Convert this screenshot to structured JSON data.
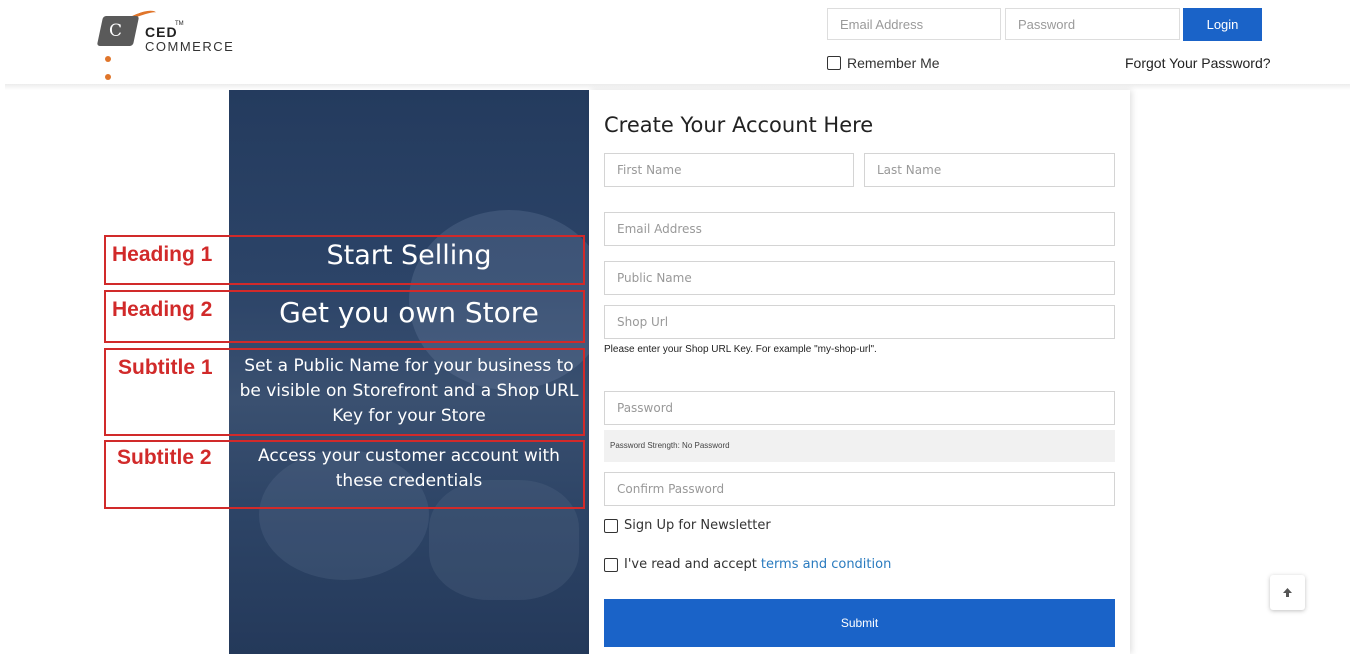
{
  "brand": {
    "logo_letter": "C",
    "name_top": "CED",
    "tm": "TM",
    "name_bottom": "COMMERCE"
  },
  "header": {
    "email_placeholder": "Email Address",
    "password_placeholder": "Password",
    "login_label": "Login",
    "remember_label": "Remember Me",
    "forgot_label": "Forgot Your Password?"
  },
  "promo": {
    "heading1": "Start Selling",
    "heading2": "Get you own Store",
    "subtitle1": "Set a Public Name for your business to be visible on Storefront and a Shop URL Key for your Store",
    "subtitle2": "Access your customer account with these credentials"
  },
  "annotations": {
    "heading1": "Heading 1",
    "heading2": "Heading 2",
    "subtitle1": "Subtitle 1",
    "subtitle2": "Subtitle 2",
    "color": "#d12a2a"
  },
  "form": {
    "title": "Create Your Account Here",
    "first_name_placeholder": "First Name",
    "last_name_placeholder": "Last Name",
    "email_placeholder": "Email Address",
    "public_name_placeholder": "Public Name",
    "shop_url_placeholder": "Shop Url",
    "shop_url_hint": "Please enter your Shop URL Key. For example \"my-shop-url\".",
    "password_placeholder": "Password",
    "password_strength": "Password Strength: No Password",
    "confirm_password_placeholder": "Confirm Password",
    "newsletter_label": "Sign Up for Newsletter",
    "terms_prefix": "I've read and accept",
    "terms_link": "terms and condition",
    "submit_label": "Submit"
  },
  "colors": {
    "accent": "#1a63c8",
    "panel": "#2c4468",
    "link": "#2a7bbf"
  },
  "icons": {
    "scroll_top": "arrow-up-icon"
  }
}
